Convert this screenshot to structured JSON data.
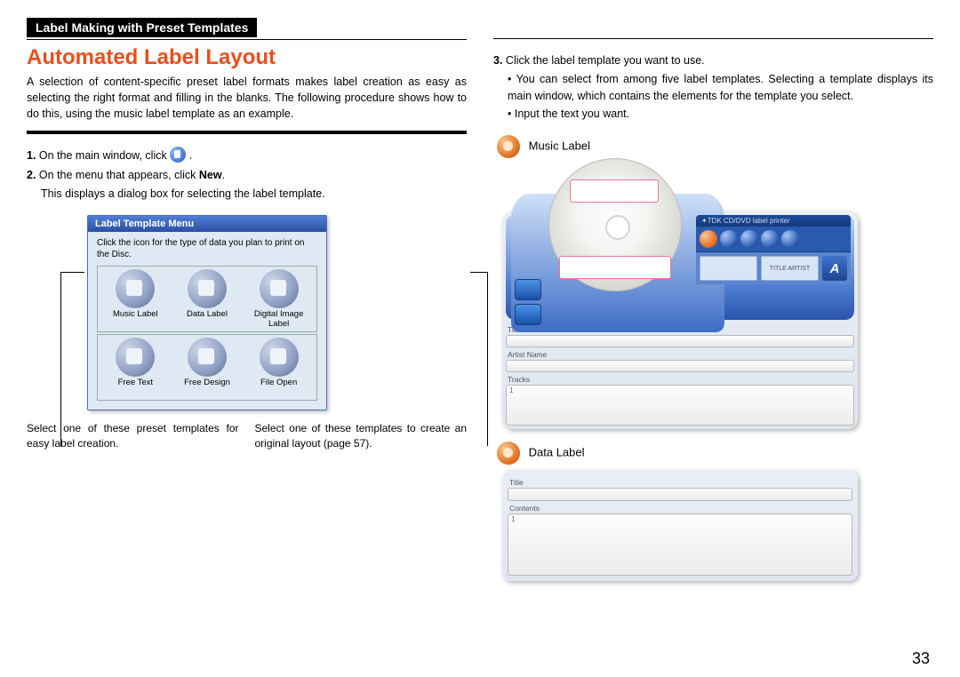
{
  "header": {
    "crumb": "Label Making with Preset Templates"
  },
  "title": "Automated Label Layout",
  "intro": "A selection of content-specific preset label formats makes label creation as easy as selecting the right format and filling in the blanks. The following procedure shows how to do this, using the music label template as an example.",
  "steps": {
    "s1_num": "1.",
    "s1_txt": "On the main window, click ",
    "s1_tail": ".",
    "s2_num": "2.",
    "s2_txt_a": "On the menu that appears, click ",
    "s2_bold": "New",
    "s2_txt_b": ".",
    "s2_sub": "This displays a dialog box for selecting the label template.",
    "s3_num": "3.",
    "s3_txt": "Click the label template you want to use.",
    "s3_b1": "You can select from among five label templates. Selecting a template displays its main window, which contains the elements for the template you select.",
    "s3_b2": "Input the text you want."
  },
  "template_menu": {
    "title": "Label Template Menu",
    "inst": "Click the icon for the type of data you plan to print on the Disc.",
    "row1": [
      "Music Label",
      "Data Label",
      "Digital Image Label"
    ],
    "row2": [
      "Free Text",
      "Free Design",
      "File Open"
    ]
  },
  "callouts": {
    "left": "Select one of these preset templates for easy label creation.",
    "right": "Select one of these templates to create an original layout (page 57)."
  },
  "labels": {
    "music": "Music Label",
    "data": "Data Label"
  },
  "app": {
    "brand": "TDK CD/DVD label printer",
    "mid_box": "TITLE\nARTIST",
    "mid_a": "A",
    "f_title": "Title",
    "f_artist": "Artist Name",
    "f_tracks": "Tracks",
    "track1": "1"
  },
  "data_app": {
    "f_title": "Title",
    "f_contents": "Contents",
    "row1": "1"
  },
  "page_number": "33"
}
